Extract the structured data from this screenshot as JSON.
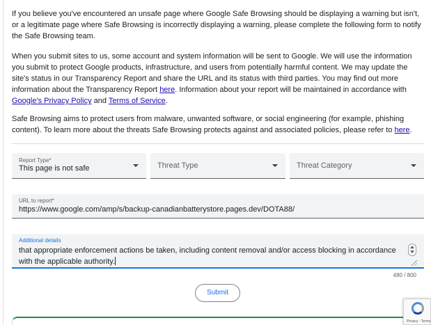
{
  "intro": {
    "p1": "If you believe you've encountered an unsafe page where Google Safe Browsing should be displaying a warning but isn't, or a legitimate page where Safe Browsing is incorrectly displaying a warning, please complete the following form to notify the Safe Browsing team.",
    "p2_text_a": "When you submit sites to us, some account and system information will be sent to Google. We will use the information you submit to protect Google products, infrastructure, and users from potentially harmful content. We may update the site's status in our Transparency Report and share the URL and its status with third parties. You may find out more information about the Transparency Report ",
    "p2_link_here": "here",
    "p2_text_b": ". Information about your report will be maintained in accordance with ",
    "p2_link_privacy": "Google's Privacy Policy",
    "p2_text_c": " and ",
    "p2_link_terms": "Terms of Service",
    "p2_text_d": ".",
    "p3_text": "Safe Browsing aims to protect users from malware, unwanted software, or social engineering (for example, phishing content). To learn more about the threats Safe Browsing protects against and associated policies, please refer to ",
    "p3_link_here": "here",
    "p3_end": "."
  },
  "form": {
    "report_type": {
      "label": "Report Type*",
      "value": "This page is not safe"
    },
    "threat_type": {
      "placeholder": "Threat Type"
    },
    "threat_category": {
      "placeholder": "Threat Category"
    },
    "url": {
      "label": "URL to report*",
      "value": "https://www.google.com/amp/s/backup-canadianbatterystore.pages.dev/DOTA88/"
    },
    "details": {
      "label": "Additional details",
      "value": "that appropriate enforcement actions be taken, including content removal and/or access blocking in accordance with the applicable authority.",
      "counter": "480 / 800"
    },
    "submit_label": "Submit"
  },
  "recaptcha": {
    "text": "Privacy - Terms"
  },
  "colors": {
    "link": "#1a0dab",
    "accent": "#1a73e8",
    "field_bg": "#f1f3f4",
    "success": "#1e8e3e"
  }
}
